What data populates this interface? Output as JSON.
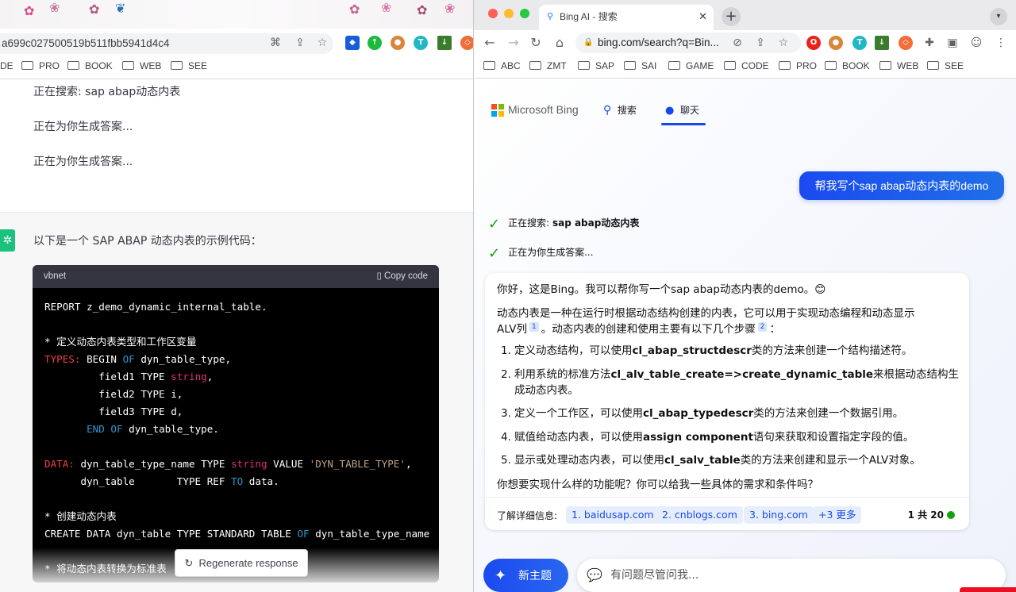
{
  "left": {
    "url": "a699c027500519b511fbb5941d4c4",
    "bookmarks": [
      "DE",
      "PRO",
      "BOOK",
      "WEB",
      "SEE"
    ],
    "status_lines": [
      "正在搜索: sap abap动态内表",
      "正在为你生成答案...",
      "正在为你生成答案..."
    ],
    "intro": "以下是一个 SAP ABAP 动态内表的示例代码：",
    "code_lang": "vbnet",
    "copy_label": "Copy code",
    "regenerate_label": "Regenerate response"
  },
  "right": {
    "tab_title": "Bing AI - 搜索",
    "url": "bing.com/search?q=Bin...",
    "bookmarks": [
      "ABC",
      "ZMT",
      "SAP",
      "SAI",
      "GAME",
      "CODE",
      "PRO",
      "BOOK",
      "WEB",
      "SEE"
    ],
    "brand": "Microsoft Bing",
    "nav_search": "搜索",
    "nav_chat": "聊天",
    "user_message": "帮我写个sap abap动态内表的demo",
    "progress": [
      {
        "prefix": "正在搜索: ",
        "bold": "sap abap动态内表"
      },
      {
        "prefix": "正在为你生成答案...",
        "bold": ""
      }
    ],
    "answer": {
      "greeting": "你好，这是Bing。我可以帮你写一个sap abap动态内表的demo。😊",
      "para1_a": "动态内表是一种在运行时根据动态结构创建的内表，它可以用于实现动态编程和动态显示",
      "para1_b": "ALV列",
      "cite1": "1",
      "para1_c": "。动态内表的创建和使用主要有以下几个步骤",
      "cite2": "2",
      "para1_d": "：",
      "steps": [
        {
          "n": "1.",
          "a": "定义动态结构，可以使用",
          "b": "cl_abap_structdescr",
          "c": "类的方法来创建一个结构描述符。"
        },
        {
          "n": "2.",
          "a": "利用系统的标准方法",
          "b": "cl_alv_table_create=>create_dynamic_table",
          "c": "来根据动态结构生成动态内表。"
        },
        {
          "n": "3.",
          "a": "定义一个工作区，可以使用",
          "b": "cl_abap_typedescr",
          "c": "类的方法来创建一个数据引用。"
        },
        {
          "n": "4.",
          "a": "赋值给动态内表，可以使用",
          "b": "assign component",
          "c": "语句来获取和设置指定字段的值。"
        },
        {
          "n": "5.",
          "a": "显示或处理动态内表，可以使用",
          "b": "cl_salv_table",
          "c": "类的方法来创建和显示一个ALV对象。"
        }
      ],
      "question": "你想要实现什么样的功能呢？你可以给我一些具体的需求和条件吗？",
      "learn_more": "了解详细信息:",
      "sources": [
        "1. baidusap.com",
        "2. cnblogs.com",
        "3. bing.com",
        "+3 更多"
      ],
      "count": "1 共 20"
    },
    "new_topic": "新主题",
    "input_placeholder": "有问题尽管问我..."
  },
  "colors": {
    "bing_blue": "#174ae4",
    "check_green": "#13a10e",
    "code_bg": "#000000",
    "chatgpt_green": "#19c37d"
  }
}
